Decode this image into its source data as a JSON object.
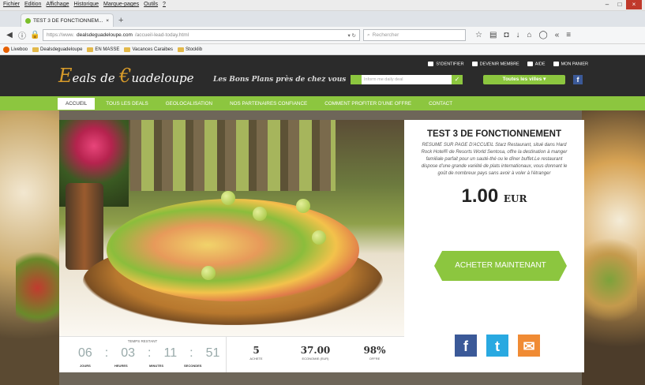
{
  "menubar": [
    "Fichier",
    "Edition",
    "Affichage",
    "Historique",
    "Marque-pages",
    "Outils",
    "?"
  ],
  "tab": {
    "title": "TEST 3 DE FONCTIONNEM...",
    "close": "×",
    "new": "+"
  },
  "url": {
    "prefix": "https://www.",
    "domain": "dealsdeguadeloupe.com",
    "path": "/accueil-lead-today.html",
    "search": "Rechercher"
  },
  "bookmarks": [
    "Liveboo",
    "Dealsdeguadeloupe",
    "EN MASSE",
    "Vacances Caraibes",
    "Stocklib"
  ],
  "header": {
    "logo_e1": "E",
    "logo_w1": "eals",
    "logo_de": "de",
    "logo_e2": "€",
    "logo_w2": "uadeloupe",
    "slogan": "Les Bons Plans près de chez vous",
    "deal_placeholder": "Inform me daily deal",
    "cities": "Toutes les villes",
    "links": [
      "S'IDENTIFIER",
      "DEVENIR MEMBRE",
      "AIDE",
      "MON PANIER"
    ]
  },
  "nav": [
    "ACCUEIL",
    "TOUS LES DEALS",
    "GEOLOCALISATION",
    "NOS PARTENAIRES CONFIANCE",
    "COMMENT PROFITER D'UNE OFFRE",
    "CONTACT"
  ],
  "deal": {
    "title": "TEST 3 DE FONCTIONNEMENT",
    "description": "RESUME SUR PAGE D'ACCUEIL Starz Restaurant, situé dans Hard Rock Hotel® de Resorts World Sentosa, offre la destination à manger familiale parfait pour un sauté-thé ou le dîner buffet.Le restaurant dispose d'une grande variété de plats internationaux, vous donnant le goût de nombreux pays sans avoir à voler à l'étranger",
    "price": "1.00",
    "currency": "EUR",
    "buy": "ACHETER MAINTENANT"
  },
  "timer": {
    "label": "TEMPS RESTANT",
    "days": "06",
    "hours": "03",
    "minutes": "11",
    "seconds": "51",
    "l_days": "JOURS",
    "l_hours": "HEURES",
    "l_minutes": "MINUTES",
    "l_seconds": "SECONDES"
  },
  "stats": [
    {
      "value": "5",
      "label": "ACHETE"
    },
    {
      "value": "37.00",
      "label": "ECONOMIE (EUR)"
    },
    {
      "value": "98%",
      "label": "OFFRE"
    }
  ]
}
